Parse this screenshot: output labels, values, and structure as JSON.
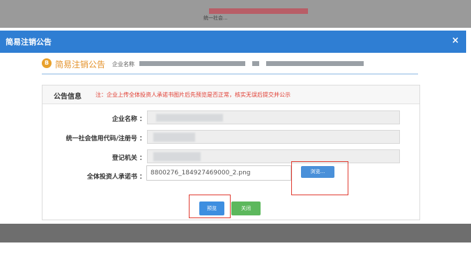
{
  "dialog": {
    "title": "简易注销公告",
    "close_glyph": "×"
  },
  "notice": {
    "icon_glyph": "B",
    "title": "简易注销公告",
    "company_label": "企业名称"
  },
  "panel": {
    "title": "公告信息",
    "note": "注：企业上传全体投资人承诺书图片后先预览是否正常，核实无误后提交并公示"
  },
  "form": {
    "company_name_label": "企业名称 ：",
    "credit_code_label": "统一社会信用代码/注册号 ：",
    "authority_label": "登记机关 ：",
    "commitment_label": "全体投资人承诺书 ：",
    "commitment_file": "8800276_184927469000_2.png",
    "browse_label": "浏览..."
  },
  "actions": {
    "preview_label": "预览",
    "close_label": "关闭"
  },
  "background": {
    "ghost_text": "统一社会..."
  },
  "colors": {
    "header_blue": "#2f7ed3",
    "accent_orange": "#e4922a",
    "note_red": "#e03a2f",
    "preview_blue": "#3d8ee0",
    "close_green": "#5cb85c",
    "highlight_red": "#e0392e"
  }
}
